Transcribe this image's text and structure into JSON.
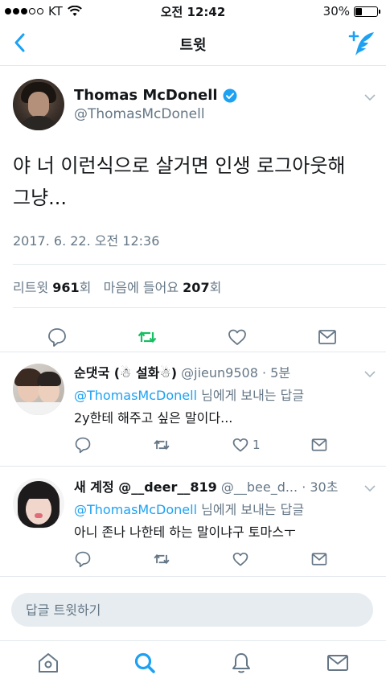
{
  "status_bar": {
    "carrier": "KT",
    "time": "오전 12:42",
    "battery_percent": "30%",
    "battery_level": 0.3
  },
  "nav": {
    "title": "트윗",
    "back_icon": "chevron-left-icon",
    "compose_icon": "compose-feather-icon"
  },
  "main_tweet": {
    "author_name": "Thomas McDonell",
    "author_handle": "@ThomasMcDonell",
    "verified": true,
    "text_line1": "야 너 이런식으로 살거면 인생 로그아웃해",
    "text_line2": "그냥...",
    "date": "2017. 6. 22. 오전 12:36",
    "stats": {
      "retweet_label": "리트윗",
      "retweet_count": "961",
      "retweet_suffix": "회",
      "like_label": "마음에 들어요",
      "like_count": "207",
      "like_suffix": "회"
    }
  },
  "replies": [
    {
      "name": "순댓국 (☃ 설화☃)",
      "handle": "@jieun9508",
      "time": "· 5분",
      "mention": "@ThomasMcDonell",
      "reply_suffix": " 님에게 보내는 답글",
      "text": "2y한테 해주고 싶은 말이다...",
      "like_count": "1"
    },
    {
      "name": "새 계정 @__deer__819",
      "handle": "@__bee_d...",
      "time": "· 30초",
      "mention": "@ThomasMcDonell",
      "reply_suffix": " 님에게 보내는 답글",
      "text": "아니 존나 나한테 하는 말이냐구 토마스ㅜ",
      "like_count": ""
    }
  ],
  "reply_box": {
    "placeholder": "답글 트윗하기"
  },
  "colors": {
    "accent": "#1da1f2",
    "retweet_green": "#17bf63",
    "gray": "#657786",
    "divider": "#e1e8ed"
  }
}
